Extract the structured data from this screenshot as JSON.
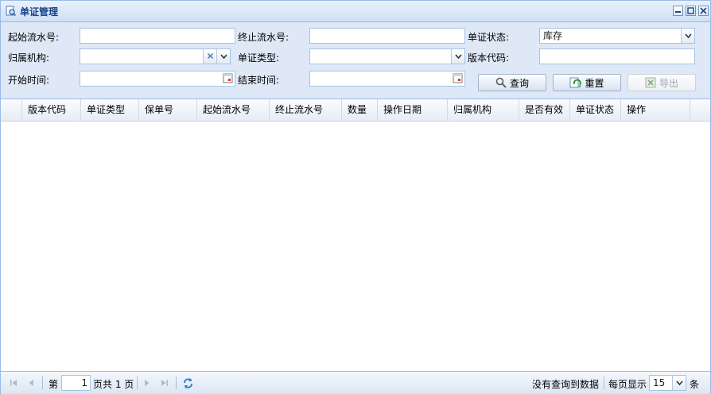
{
  "window": {
    "title": "单证管理"
  },
  "form": {
    "start_serial": {
      "label": "起始流水号:",
      "value": ""
    },
    "end_serial": {
      "label": "终止流水号:",
      "value": ""
    },
    "status": {
      "label": "单证状态:",
      "value": "库存"
    },
    "org": {
      "label": "归属机构:",
      "value": ""
    },
    "doc_type": {
      "label": "单证类型:",
      "value": ""
    },
    "version_code": {
      "label": "版本代码:",
      "value": ""
    },
    "start_time": {
      "label": "开始时间:",
      "value": ""
    },
    "end_time": {
      "label": "结束时间:",
      "value": ""
    }
  },
  "buttons": {
    "query": "查询",
    "reset": "重置",
    "export": "导出"
  },
  "grid": {
    "columns": [
      "版本代码",
      "单证类型",
      "保单号",
      "起始流水号",
      "终止流水号",
      "数量",
      "操作日期",
      "归属机构",
      "是否有效",
      "单证状态",
      "操作"
    ],
    "rows": []
  },
  "pager": {
    "page_prefix": "第",
    "page_value": "1",
    "page_suffix": "页共 1 页",
    "empty_msg": "没有查询到数据",
    "per_page_label": "每页显示",
    "per_page_value": "15",
    "per_page_unit": "条"
  }
}
